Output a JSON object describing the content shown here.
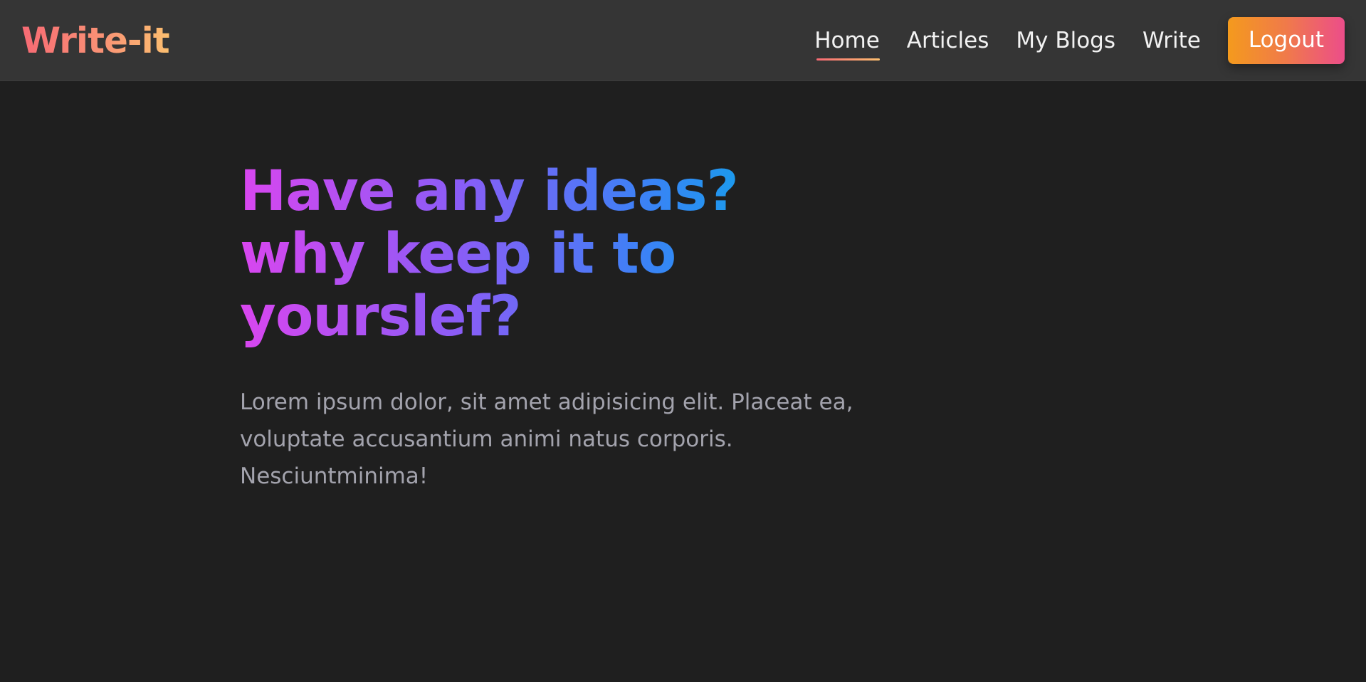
{
  "brand": {
    "name": "Write-it"
  },
  "nav": {
    "links": [
      "Home",
      "Articles",
      "My Blogs",
      "Write"
    ],
    "active": "Home",
    "logout_label": "Logout"
  },
  "hero": {
    "title_lines": [
      "Have any ideas?",
      "why keep it to",
      "yourslef?"
    ],
    "description_lines": [
      "Lorem ipsum dolor, sit amet adipisicing elit. Placeat ea,",
      "voluptate accusantium animi natus corporis.",
      "Nesciuntminima!"
    ]
  },
  "colors": {
    "background": "#1f1f1f",
    "navbar": "#353535",
    "brand_gradient": [
      "#f76a74",
      "#fcbf6f"
    ],
    "title_gradient": [
      "#d946ef",
      "#8b5cf6",
      "#3b82f6",
      "#0ea5e9"
    ],
    "logout_gradient": [
      "#f49a1d",
      "#ec4d8a"
    ],
    "description_text": "#a3a3ad"
  }
}
